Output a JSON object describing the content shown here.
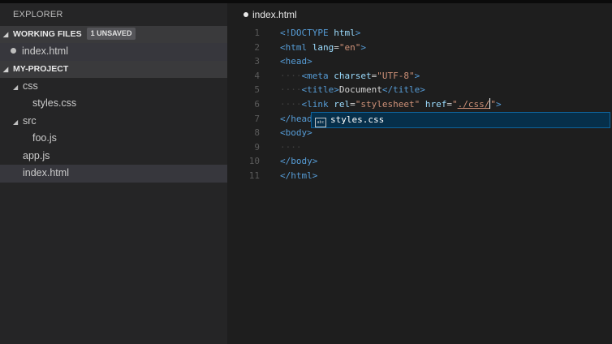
{
  "sidebar": {
    "title": "EXPLORER",
    "working_files": {
      "label": "WORKING FILES",
      "badge": "1 UNSAVED",
      "files": [
        {
          "name": "index.html",
          "unsaved": true
        }
      ]
    },
    "project": {
      "label": "MY-PROJECT",
      "css_folder": "css",
      "styles_file": "styles.css",
      "src_folder": "src",
      "foo_file": "foo.js",
      "app_file": "app.js",
      "index_file": "index.html"
    }
  },
  "editor": {
    "tab": {
      "label": "index.html",
      "unsaved": true
    },
    "line_numbers": [
      "1",
      "2",
      "3",
      "4",
      "5",
      "6",
      "7",
      "8",
      "9",
      "10",
      "11"
    ],
    "suggestion": {
      "label": "styles.css",
      "icon": "file-icon"
    }
  },
  "colors": {
    "tag": "#569cd6",
    "attribute": "#9cdcfe",
    "string": "#ce9178",
    "suggestion_bg": "#062f4a"
  }
}
